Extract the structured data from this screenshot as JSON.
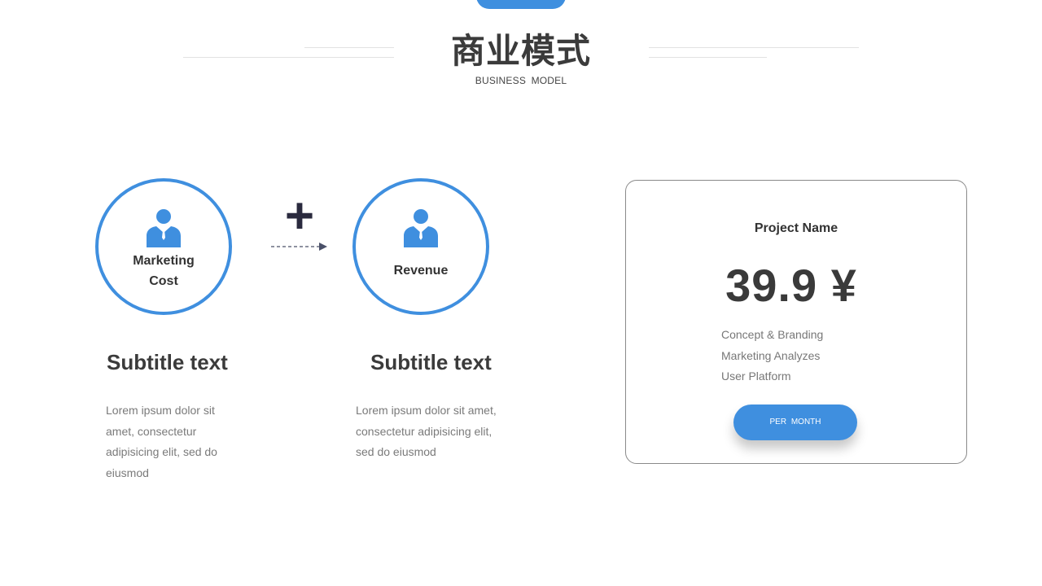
{
  "header": {
    "title": "商业模式",
    "subtitle": "BUSINESS MODEL"
  },
  "colors": {
    "accent": "#3f8fdf",
    "text_dark": "#3b3b3b",
    "text_muted": "#7a7a7a"
  },
  "icons": {
    "person": "person-icon",
    "plus": "+"
  },
  "left_item": {
    "label_line1": "Marketing",
    "label_line2": "Cost",
    "subtitle": "Subtitle text",
    "desc_lines": [
      "Lorem ipsum dolor sit",
      "amet, consectetur",
      "adipisicing elit, sed do",
      "eiusmod"
    ]
  },
  "right_item": {
    "label": "Revenue",
    "subtitle": "Subtitle text",
    "desc_lines": [
      "Lorem ipsum dolor sit amet,",
      "consectetur adipisicing elit,",
      "sed do eiusmod"
    ]
  },
  "card": {
    "project_name": "Project Name",
    "price": "39.9 ¥",
    "features": [
      "Concept & Branding",
      "Marketing Analyzes",
      "User Platform"
    ],
    "button_label": "PER MONTH"
  }
}
